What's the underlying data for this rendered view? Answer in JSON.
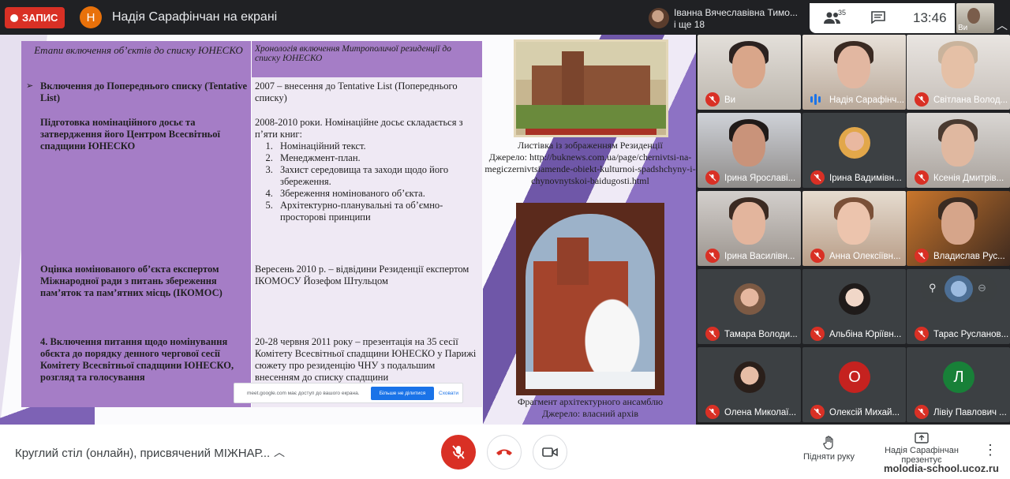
{
  "topbar": {
    "record_label": "ЗАПИС",
    "presenter_initial": "Н",
    "presenting_title": "Надія Сарафінчан на екрані",
    "pinned_name": "Іванна Вячеславівна Тимо...",
    "pinned_more": "і ще 18",
    "people_count": "35",
    "time": "13:46",
    "self_label": "Ви"
  },
  "slide": {
    "table": {
      "header_left": "Етапи включення об’єктів до списку ЮНЕСКО",
      "header_right": "Хронологія включення Митрополичої резиденції до списку ЮНЕСКО",
      "rows": [
        {
          "stage": "Включення до Попереднього списку (Tentative List)",
          "chronology": "2007 – внесення до Tentative List (Попереднього списку)"
        },
        {
          "stage": "Підготовка номінаційного досьє та затвердження його Центром Всесвітньої спадщини ЮНЕСКО",
          "chronology": "2008-2010 роки. Номінаційне досьє складається з п’яти книг:",
          "items": [
            "Номінаційний текст.",
            "Менеджмент-план.",
            "Захист середовища та заходи щодо його збереження.",
            "Збереження номінованого об’єкта.",
            "Архітектурно-планувальні та об’ємно-просторові принципи"
          ]
        },
        {
          "stage": "Оцінка номінованого об’єкта експертом Міжнародної ради з питань збереження пам’яток та пам’ятних місць (ІКОМОС)",
          "chronology": "Вересень 2010 р. – відвідини Резиденції експертом ІКОМОСУ Йозефом Штульцом"
        },
        {
          "stage": "4. Включення питання щодо номінування обєкта до порядку денного чергової сесії Комітету Всесвітньої спадщини ЮНЕСКО, розгляд та голосування",
          "chronology": "20-28 червня 2011 року – презентація на 35 сесії Комітету Всесвітньої спадщини ЮНЕСКО у Парижі сюжету про резиденцію ЧНУ з подальшим внесенням до списку спадщини"
        }
      ]
    },
    "share_banner": {
      "message": "meet.google.com має доступ до вашого екрана.",
      "stop_label": "Більше не ділитися",
      "hide_label": "Сховати"
    },
    "caption_top": {
      "line1": "Листівка із зображенням Резиденції",
      "line2": "Джерело: http://buknews.com.ua/page/chernivtsi-na-megiczernivtsiamende-obiekt-kulturnoi-spadshchyny-i-chynovnytskoi-baidugosti.html"
    },
    "caption_bottom": {
      "line1": "Фрагмент архітектурного ансамблю",
      "line2": "Джерело: власний архів"
    }
  },
  "participants": [
    {
      "name": "Ви",
      "muted": true
    },
    {
      "name": "Надія Сарафінч...",
      "muted": false
    },
    {
      "name": "Світлана Волод...",
      "muted": true
    },
    {
      "name": "Ірина Ярославі...",
      "muted": true
    },
    {
      "name": "Ірина Вадимівн...",
      "muted": true
    },
    {
      "name": "Ксенія Дмитрів...",
      "muted": true
    },
    {
      "name": "Ірина Василівн...",
      "muted": true
    },
    {
      "name": "Анна Олексіївн...",
      "muted": true
    },
    {
      "name": "Владислав Рус...",
      "muted": true
    },
    {
      "name": "Тамара Володи...",
      "muted": true
    },
    {
      "name": "Альбіна Юріївн...",
      "muted": true
    },
    {
      "name": "Тарас Русланов...",
      "muted": true
    },
    {
      "name": "Олена Миколаї...",
      "muted": true
    },
    {
      "name": "Олексій Михай...",
      "muted": true,
      "initial": "О"
    },
    {
      "name": "Лівіу Павлович ...",
      "muted": true,
      "initial": "Л"
    }
  ],
  "bottombar": {
    "meeting_title": "Круглий стіл (онлайн), присвячений МІЖНАР...",
    "raise_hand_label": "Підняти руку",
    "present_label_line1": "Надія Сарафінчан",
    "present_label_line2": "презентує"
  },
  "watermark": "molodia-school.ucoz.ru",
  "colors": {
    "record": "#d93025",
    "presenter_avatar": "#e8710a",
    "avatar_o": "#c5221f",
    "avatar_l": "#188038",
    "table_purple": "#a57dc6",
    "speaking_blue": "#1a73e8"
  }
}
